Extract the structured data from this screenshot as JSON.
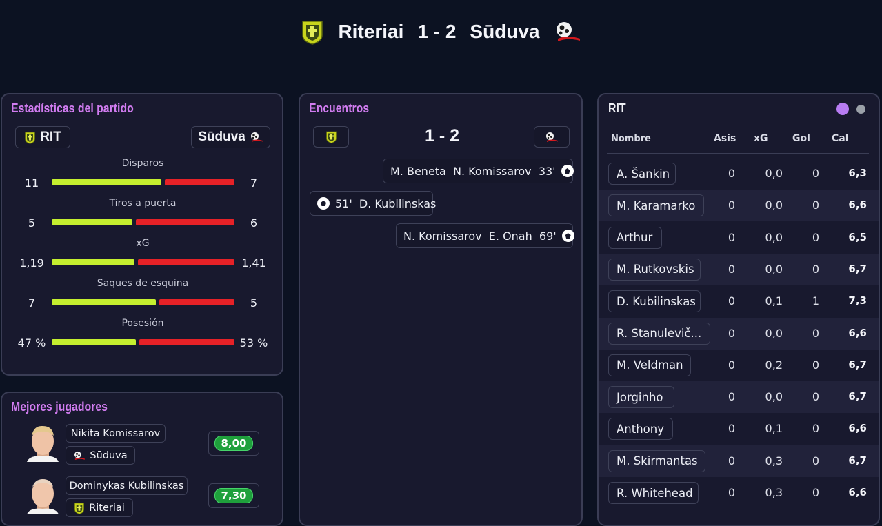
{
  "header": {
    "home_team": "Riteriai",
    "score": "1 - 2",
    "away_team": "Sūduva"
  },
  "stats_panel": {
    "title": "Estadísticas del partido",
    "home_label": "RIT",
    "away_label": "Sūduva",
    "stats": [
      {
        "label": "Disparos",
        "home": "11",
        "away": "7",
        "home_frac": 0.61
      },
      {
        "label": "Tiros a puerta",
        "home": "5",
        "away": "6",
        "home_frac": 0.45
      },
      {
        "label": "xG",
        "home": "1,19",
        "away": "1,41",
        "home_frac": 0.46
      },
      {
        "label": "Saques de esquina",
        "home": "7",
        "away": "5",
        "home_frac": 0.58
      },
      {
        "label": "Posesión",
        "home": "47 %",
        "away": "53 %",
        "home_frac": 0.47
      }
    ]
  },
  "best_players": {
    "title": "Mejores jugadores",
    "players": [
      {
        "name": "Nikita Komissarov",
        "team": "Sūduva",
        "rating": "8,00"
      },
      {
        "name": "Dominykas Kubilinskas",
        "team": "Riteriai",
        "rating": "7,30"
      }
    ]
  },
  "events_panel": {
    "title": "Encuentros",
    "score": "1 - 2",
    "events": [
      {
        "text": "M. Beneta  N. Komissarov  33'",
        "side": "away"
      },
      {
        "text": "51'  D. Kubilinskas",
        "side": "home"
      },
      {
        "text": "N. Komissarov  E. Onah  69'",
        "side": "away"
      }
    ]
  },
  "lineup_panel": {
    "team": "RIT",
    "columns": {
      "name": "Nombre",
      "assists": "Asis",
      "xg": "xG",
      "goals": "Gol",
      "rating": "Cal"
    },
    "players": [
      {
        "name": "A. Šankin",
        "assists": "0",
        "xg": "0,0",
        "goals": "0",
        "rating": "6,3"
      },
      {
        "name": "M. Karamarko",
        "assists": "0",
        "xg": "0,0",
        "goals": "0",
        "rating": "6,6"
      },
      {
        "name": "Arthur",
        "assists": "0",
        "xg": "0,0",
        "goals": "0",
        "rating": "6,5"
      },
      {
        "name": "M. Rutkovskis",
        "assists": "0",
        "xg": "0,0",
        "goals": "0",
        "rating": "6,7"
      },
      {
        "name": "D. Kubilinskas",
        "assists": "0",
        "xg": "0,1",
        "goals": "1",
        "rating": "7,3"
      },
      {
        "name": "R. Stanulevič...",
        "assists": "0",
        "xg": "0,0",
        "goals": "0",
        "rating": "6,6"
      },
      {
        "name": "M. Veldman",
        "assists": "0",
        "xg": "0,2",
        "goals": "0",
        "rating": "6,7"
      },
      {
        "name": "Jorginho",
        "assists": "0",
        "xg": "0,0",
        "goals": "0",
        "rating": "6,7"
      },
      {
        "name": "Anthony",
        "assists": "0",
        "xg": "0,1",
        "goals": "0",
        "rating": "6,6"
      },
      {
        "name": "M. Skirmantas",
        "assists": "0",
        "xg": "0,3",
        "goals": "0",
        "rating": "6,7"
      },
      {
        "name": "R. Whitehead",
        "assists": "0",
        "xg": "0,3",
        "goals": "0",
        "rating": "6,6"
      }
    ]
  },
  "colors": {
    "accent_title": "#d17cf0",
    "home_bar": "#c5ef2f",
    "away_bar": "#e62127",
    "rating_badge": "#1fa03c",
    "active_dot": "#b77cf2"
  },
  "icons": {
    "home_crest": "riteriai-crest-icon",
    "away_crest": "suduva-crest-icon",
    "goal": "soccer-ball-icon"
  }
}
